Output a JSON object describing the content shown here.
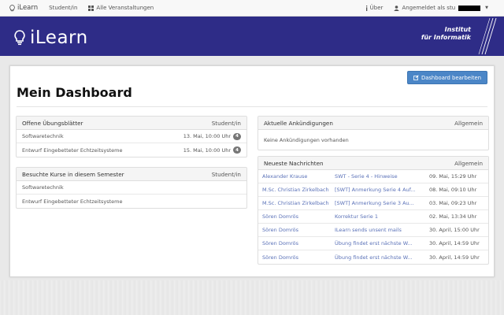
{
  "topnav": {
    "brand": "iLearn",
    "student_link": "Student/in",
    "courses_link": "Alle Veranstaltungen",
    "about_link": "Über",
    "login_label": "Angemeldet als stu"
  },
  "banner": {
    "logo_text": "iLearn",
    "institute_line1": "Institut",
    "institute_line2": "für Informatik"
  },
  "dashboard": {
    "title": "Mein Dashboard",
    "edit_button": "Dashboard bearbeiten"
  },
  "exercises_panel": {
    "title": "Offene Übungsblätter",
    "role": "Student/in",
    "rows": [
      {
        "course": "Softwaretechnik",
        "date": "13. Mai, 10:00 Uhr",
        "count": "4"
      },
      {
        "course": "Entwurf Eingebetteter Echtzeitsysteme",
        "date": "15. Mai, 10:00 Uhr",
        "count": "4"
      }
    ]
  },
  "courses_panel": {
    "title": "Besuchte Kurse in diesem Semester",
    "role": "Student/in",
    "rows": [
      "Softwaretechnik",
      "Entwurf Eingebetteter Echtzeitsysteme"
    ]
  },
  "announcements_panel": {
    "title": "Aktuelle Ankündigungen",
    "scope": "Allgemein",
    "empty_text": "Keine Ankündigungen vorhanden"
  },
  "news_panel": {
    "title": "Neueste Nachrichten",
    "scope": "Allgemein",
    "rows": [
      {
        "sender": "Alexander Krause",
        "subject": "SWT - Serie 4 - Hinweise",
        "date": "09. Mai, 15:29 Uhr"
      },
      {
        "sender": "M.Sc. Christian Zirkelbach",
        "subject": "[SWT] Anmerkung Serie 4 Auf...",
        "date": "08. Mai, 09:10 Uhr"
      },
      {
        "sender": "M.Sc. Christian Zirkelbach",
        "subject": "[SWT] Anmerkung Serie 3 Au...",
        "date": "03. Mai, 09:23 Uhr"
      },
      {
        "sender": "Sören Domrös",
        "subject": "Korrektur Serie 1",
        "date": "02. Mai, 13:34 Uhr"
      },
      {
        "sender": "Sören Domrös",
        "subject": "ILearn sends unsent mails",
        "date": "30. April, 15:00 Uhr"
      },
      {
        "sender": "Sören Domrös",
        "subject": "Übung findet erst nächste W...",
        "date": "30. April, 14:59 Uhr"
      },
      {
        "sender": "Sören Domrös",
        "subject": "Übung findet erst nächste W...",
        "date": "30. April, 14:59 Uhr"
      }
    ]
  },
  "icons": {
    "brand": "lightbulb-icon",
    "courses": "grid-icon",
    "about": "info-icon",
    "user": "user-icon",
    "edit": "edit-icon"
  },
  "colors": {
    "banner": "#2e2c87",
    "button": "#4b86c7",
    "link": "#5b72b8",
    "badge": "#777777"
  }
}
